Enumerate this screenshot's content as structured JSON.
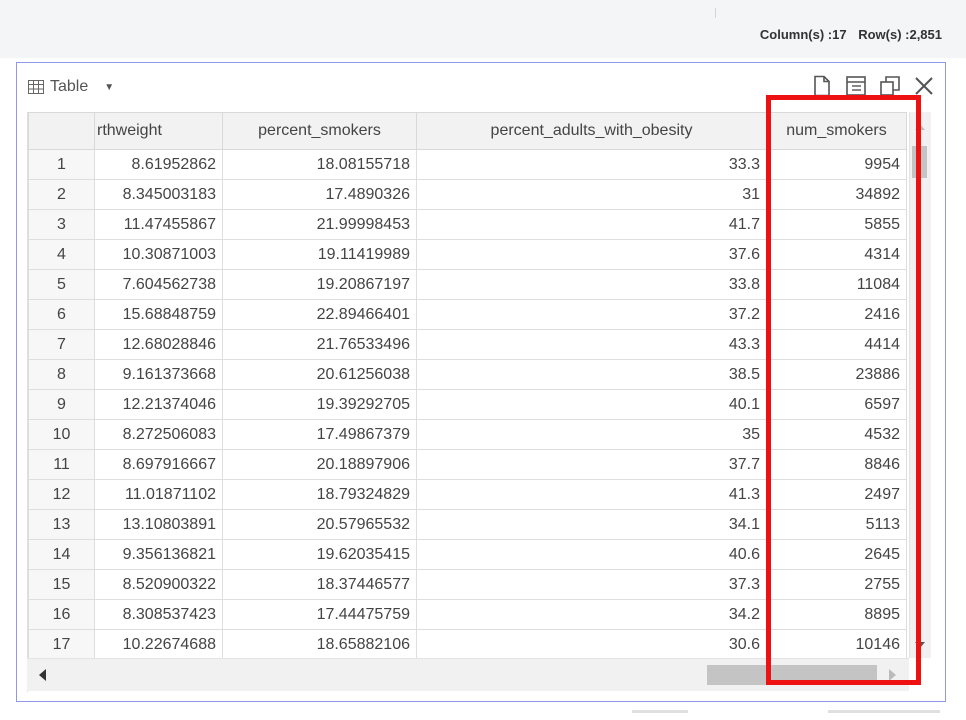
{
  "status": {
    "columns_text": "Column(s) :17",
    "rows_text": "Row(s) :2,851"
  },
  "panel": {
    "view_label": "Table",
    "icons": [
      "export-icon",
      "column-settings-icon",
      "restore-window-icon",
      "close-icon"
    ]
  },
  "table": {
    "columns": [
      "rthweight",
      "percent_smokers",
      "percent_adults_with_obesity",
      "num_smokers"
    ],
    "rows": [
      [
        "1",
        "8.61952862",
        "18.08155718",
        "33.3",
        "9954"
      ],
      [
        "2",
        "8.345003183",
        "17.4890326",
        "31",
        "34892"
      ],
      [
        "3",
        "11.47455867",
        "21.99998453",
        "41.7",
        "5855"
      ],
      [
        "4",
        "10.30871003",
        "19.11419989",
        "37.6",
        "4314"
      ],
      [
        "5",
        "7.604562738",
        "19.20867197",
        "33.8",
        "11084"
      ],
      [
        "6",
        "15.68848759",
        "22.89466401",
        "37.2",
        "2416"
      ],
      [
        "7",
        "12.68028846",
        "21.76533496",
        "43.3",
        "4414"
      ],
      [
        "8",
        "9.161373668",
        "20.61256038",
        "38.5",
        "23886"
      ],
      [
        "9",
        "12.21374046",
        "19.39292705",
        "40.1",
        "6597"
      ],
      [
        "10",
        "8.272506083",
        "17.49867379",
        "35",
        "4532"
      ],
      [
        "11",
        "8.697916667",
        "20.18897906",
        "37.7",
        "8846"
      ],
      [
        "12",
        "11.01871102",
        "18.79324829",
        "41.3",
        "2497"
      ],
      [
        "13",
        "13.10803891",
        "20.57965532",
        "34.1",
        "5113"
      ],
      [
        "14",
        "9.356136821",
        "19.62035415",
        "40.6",
        "2645"
      ],
      [
        "15",
        "8.520900322",
        "18.37446577",
        "37.3",
        "2755"
      ],
      [
        "16",
        "8.308537423",
        "17.44475759",
        "34.2",
        "8895"
      ],
      [
        "17",
        "10.22674688",
        "18.65882106",
        "30.6",
        "10146"
      ]
    ]
  },
  "colors": {
    "highlight": "#ee1111",
    "panel_border": "#8e99e8"
  }
}
